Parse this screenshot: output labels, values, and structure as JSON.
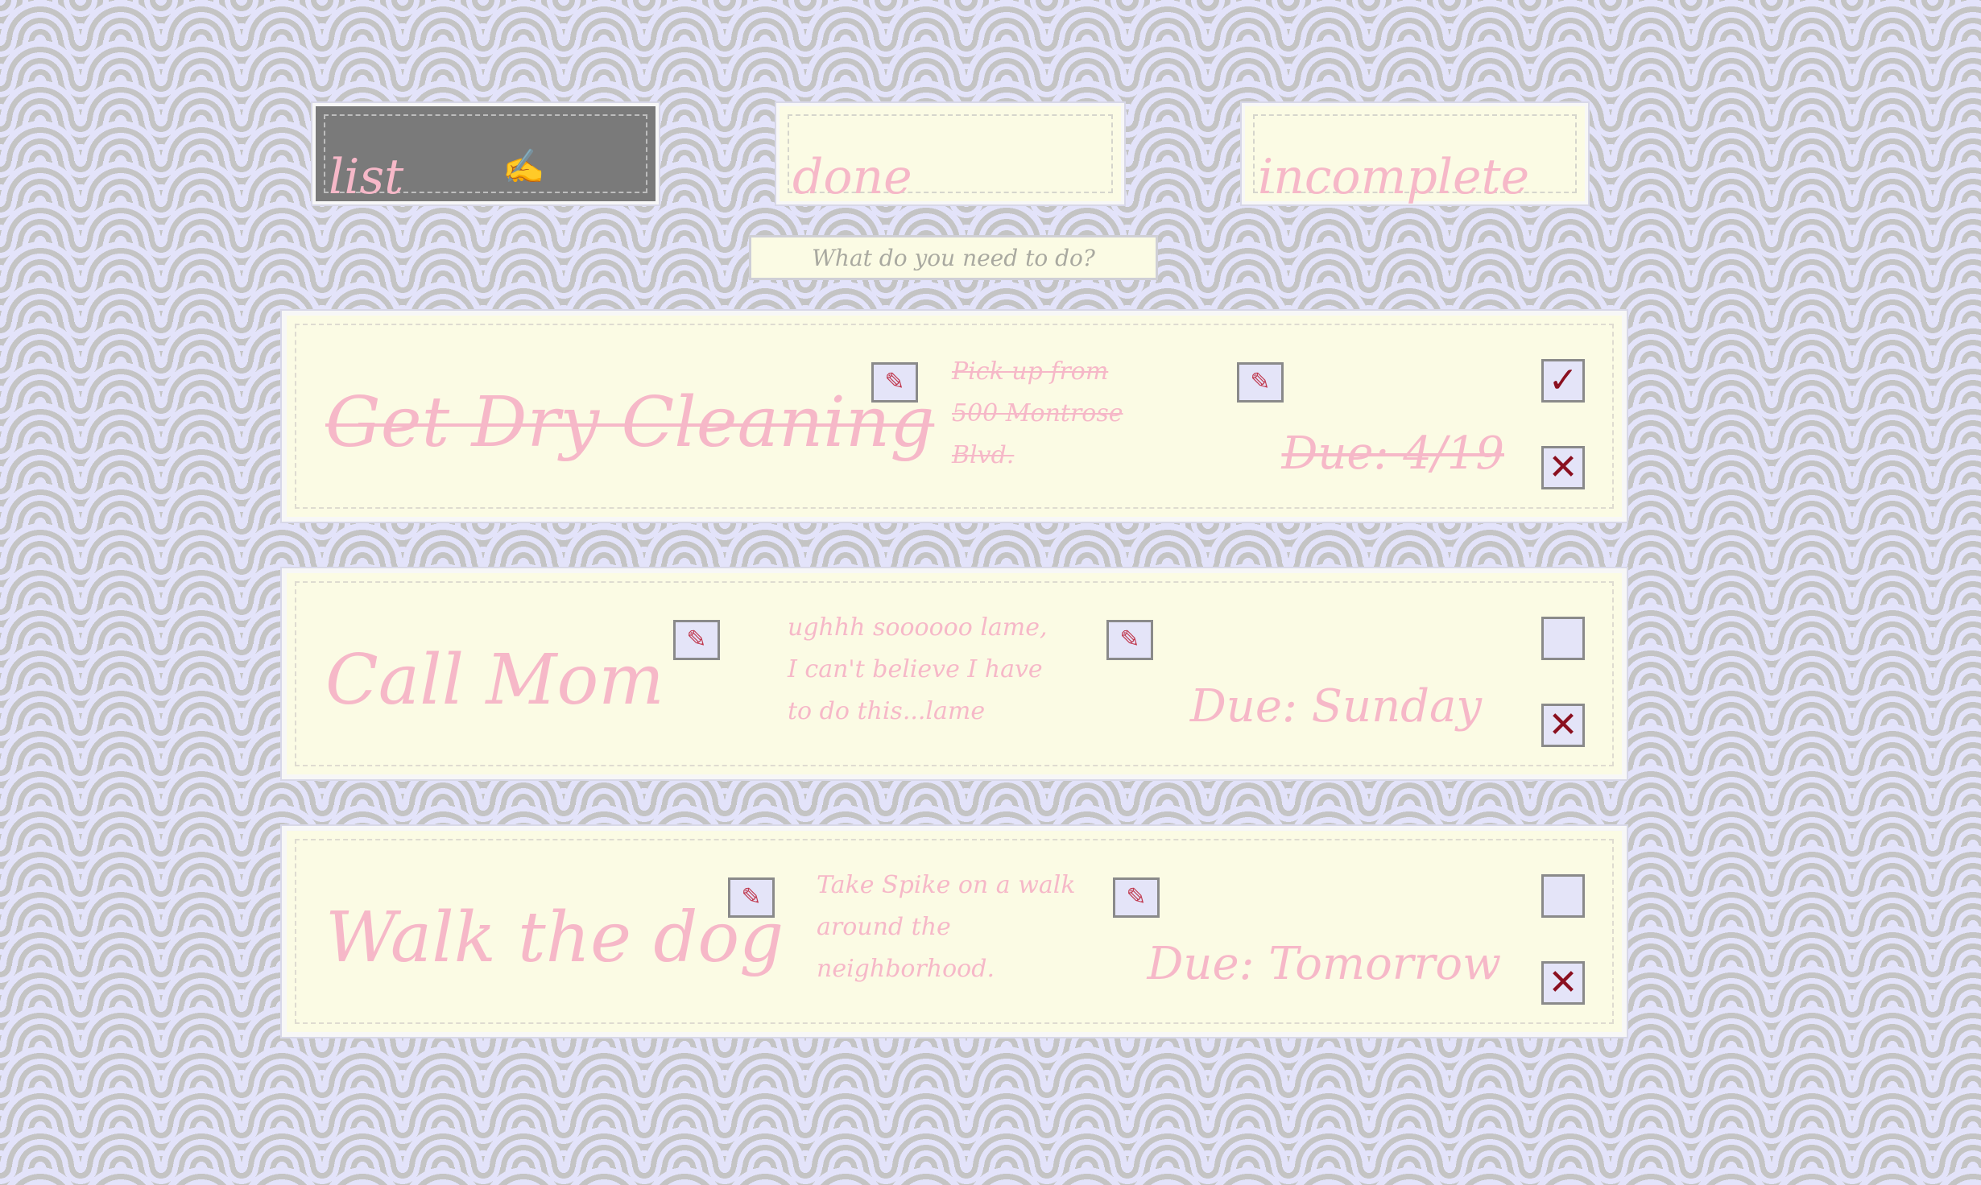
{
  "tabs": [
    {
      "label": "list",
      "active": true,
      "icon": "writing-hand-icon"
    },
    {
      "label": "done",
      "active": false
    },
    {
      "label": "incomplete",
      "active": false
    }
  ],
  "new_task": {
    "placeholder": "What do you need to do?",
    "value": ""
  },
  "tasks": [
    {
      "title": "Get Dry Cleaning",
      "note": "Pick up from 500 Montrose Blvd.",
      "due": "Due: 4/19",
      "completed": true,
      "check_mark": "✓",
      "delete_mark": "✕"
    },
    {
      "title": "Call Mom",
      "note": "ughhh soooooo lame, I can't believe I have to do this...lame",
      "due": "Due: Sunday",
      "completed": false,
      "check_mark": "",
      "delete_mark": "✕"
    },
    {
      "title": "Walk the dog",
      "note": "Take Spike on a walk around the neighborhood.",
      "due": "Due: Tomorrow",
      "completed": false,
      "check_mark": "",
      "delete_mark": "✕"
    }
  ],
  "icons": {
    "edit": "pencil-icon",
    "pen_glyph": "✍",
    "edit_glyph": "✎"
  },
  "colors": {
    "accent_pink": "#f6b8c8",
    "card": "#fbfbe4",
    "mark": "#8b1020"
  }
}
